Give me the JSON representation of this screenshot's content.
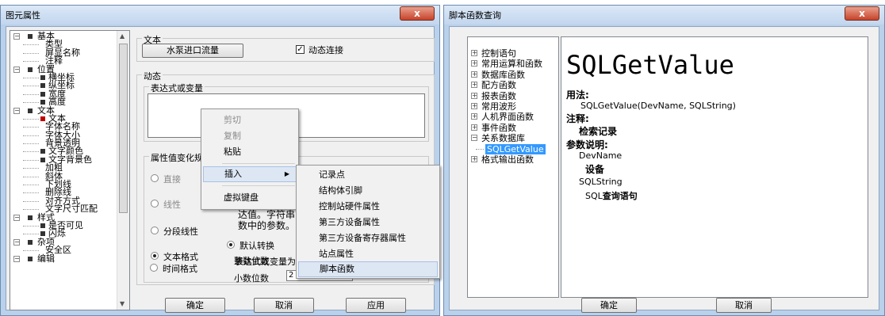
{
  "left_window": {
    "title": "图元属性",
    "close_label": "x",
    "tree": [
      {
        "label": "基本",
        "level": 0,
        "type": "group",
        "expander": "⊟"
      },
      {
        "label": "类型",
        "level": 1,
        "type": "leaf"
      },
      {
        "label": "屏显名称",
        "level": 1,
        "type": "leaf"
      },
      {
        "label": "注释",
        "level": 1,
        "type": "leaf"
      },
      {
        "label": "位置",
        "level": 0,
        "type": "group",
        "expander": "⊟"
      },
      {
        "label": "横坐标",
        "level": 1,
        "type": "dot"
      },
      {
        "label": "纵坐标",
        "level": 1,
        "type": "dot"
      },
      {
        "label": "宽度",
        "level": 1,
        "type": "dot"
      },
      {
        "label": "高度",
        "level": 1,
        "type": "dot"
      },
      {
        "label": "文本",
        "level": 0,
        "type": "group",
        "expander": "⊟"
      },
      {
        "label": "文本",
        "level": 1,
        "type": "selected"
      },
      {
        "label": "字体名称",
        "level": 1,
        "type": "leaf"
      },
      {
        "label": "字体大小",
        "level": 1,
        "type": "leaf"
      },
      {
        "label": "背景透明",
        "level": 1,
        "type": "leaf"
      },
      {
        "label": "文字颜色",
        "level": 1,
        "type": "dot"
      },
      {
        "label": "文字背景色",
        "level": 1,
        "type": "dot"
      },
      {
        "label": "加粗",
        "level": 1,
        "type": "leaf"
      },
      {
        "label": "斜体",
        "level": 1,
        "type": "leaf"
      },
      {
        "label": "下划线",
        "level": 1,
        "type": "leaf"
      },
      {
        "label": "删除线",
        "level": 1,
        "type": "leaf"
      },
      {
        "label": "对齐方式",
        "level": 1,
        "type": "leaf"
      },
      {
        "label": "文字尺寸匹配",
        "level": 1,
        "type": "leaf"
      },
      {
        "label": "样式",
        "level": 0,
        "type": "group",
        "expander": "⊟"
      },
      {
        "label": "是否可见",
        "level": 1,
        "type": "dot"
      },
      {
        "label": "闪烁",
        "level": 1,
        "type": "dot"
      },
      {
        "label": "杂项",
        "level": 0,
        "type": "group",
        "expander": "⊟"
      },
      {
        "label": "安全区",
        "level": 1,
        "type": "leaf"
      },
      {
        "label": "编辑",
        "level": 0,
        "type": "group",
        "expander": "⊟"
      }
    ],
    "text_group_title": "文本",
    "text_button_label": "水泵进口流量",
    "dynamic_link_label": "动态连接",
    "dynamic_link_checked": "✓",
    "dynamic_group_title": "动态",
    "expression_group_title": "表达式或变量",
    "value_change_group_title": "属性值变化规",
    "radio_direct": "直接",
    "radio_linear": "线性",
    "radio_segmented": "分段线性",
    "radio_text_format": "文本格式",
    "radio_time_format": "时间格式",
    "help_text_line1": "达值。字符串",
    "help_text_line2": "数中的参数。",
    "default_convert_label": "默认转换",
    "expr_or_var_label": "表达式或变量为",
    "integer_digits_label": "整数位数",
    "decimal_digits_label": "小数位数",
    "decimal_digits_value": "2",
    "ok_label": "确定",
    "cancel_label": "取消",
    "apply_label": "应用"
  },
  "context_menu": {
    "items": [
      {
        "label": "剪切",
        "enabled": false
      },
      {
        "label": "复制",
        "enabled": false
      },
      {
        "label": "粘贴",
        "enabled": true
      },
      {
        "label": "插入",
        "enabled": true,
        "submenu": true
      },
      {
        "label": "虚拟键盘",
        "enabled": true
      }
    ],
    "submenu_arrow": "▶"
  },
  "insert_submenu": {
    "items": [
      "记录点",
      "结构体引脚",
      "控制站硬件属性",
      "第三方设备属性",
      "第三方设备寄存器属性",
      "站点属性",
      "脚本函数"
    ]
  },
  "right_window": {
    "title": "脚本函数查询",
    "close_label": "x",
    "tree": [
      {
        "label": "控制语句",
        "expander": "⊞"
      },
      {
        "label": "常用运算和函数",
        "expander": "⊞"
      },
      {
        "label": "数据库函数",
        "expander": "⊞"
      },
      {
        "label": "配方函数",
        "expander": "⊞"
      },
      {
        "label": "报表函数",
        "expander": "⊞"
      },
      {
        "label": "常用波形",
        "expander": "⊞"
      },
      {
        "label": "人机界面函数",
        "expander": "⊞"
      },
      {
        "label": "事件函数",
        "expander": "⊞"
      },
      {
        "label": "关系数据库",
        "expander": "⊟"
      },
      {
        "label": "SQLGetValue",
        "expander": "",
        "selected": true
      },
      {
        "label": "格式输出函数",
        "expander": "⊞"
      }
    ],
    "func_name": "SQLGetValue",
    "usage_heading": "用法:",
    "usage_text": "SQLGetValue(DevName, SQLString)",
    "note_heading": "注释:",
    "note_text": "检索记录",
    "params_heading": "参数说明:",
    "param1_name": "DevName",
    "param1_desc": "设备",
    "param2_name": "SQLString",
    "param2_desc_prefix": "SQL",
    "param2_desc": "查询语句",
    "ok_label": "确定",
    "cancel_label": "取消"
  }
}
